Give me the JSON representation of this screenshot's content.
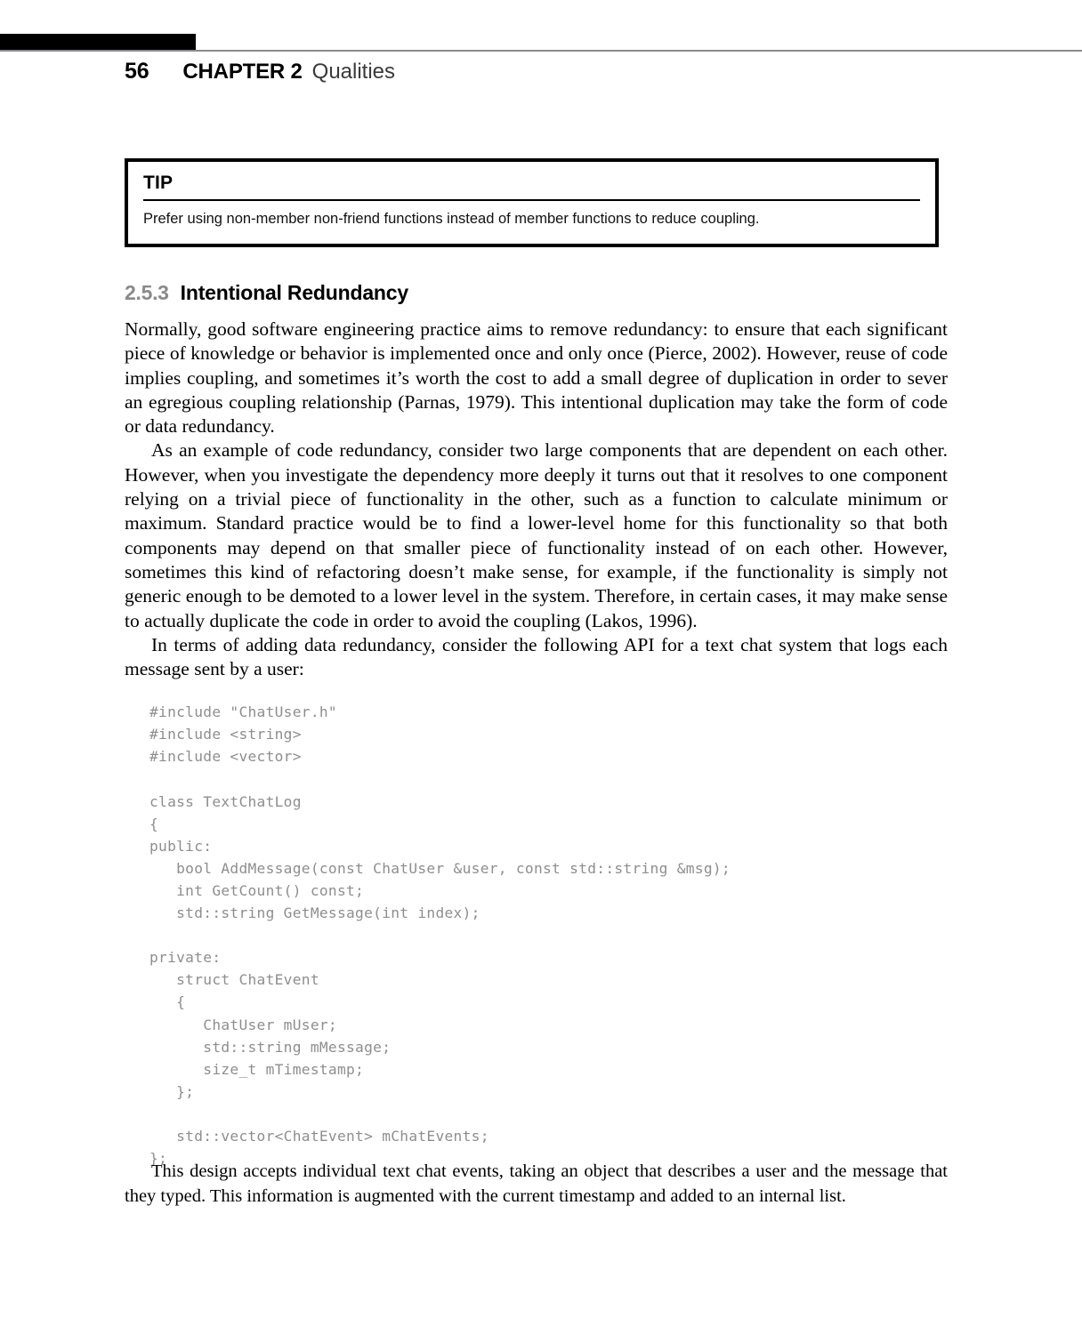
{
  "running_head": {
    "folio": "56",
    "chapter_label": "CHAPTER 2",
    "chapter_title": "Qualities"
  },
  "tip_box": {
    "heading": "TIP",
    "text": "Prefer using non-member non-friend functions instead of member functions to reduce coupling."
  },
  "section": {
    "number": "2.5.3",
    "title": "Intentional Redundancy"
  },
  "paragraphs": [
    "Normally, good software engineering practice aims to remove redundancy: to ensure that each significant piece of knowledge or behavior is implemented once and only once (Pierce, 2002). However, reuse of code implies coupling, and sometimes it’s worth the cost to add a small degree of duplication in order to sever an egregious coupling relationship (Parnas, 1979). This intentional duplication may take the form of code or data redundancy.",
    "As an example of code redundancy, consider two large components that are dependent on each other. However, when you investigate the dependency more deeply it turns out that it resolves to one component relying on a trivial piece of functionality in the other, such as a function to calculate minimum or maximum. Standard practice would be to find a lower-level home for this functionality so that both components may depend on that smaller piece of functionality instead of on each other. However, sometimes this kind of refactoring doesn’t make sense, for example, if the functionality is simply not generic enough to be demoted to a lower level in the system. Therefore, in certain cases, it may make sense to actually duplicate the code in order to avoid the coupling (Lakos, 1996).",
    "In terms of adding data redundancy, consider the following API for a text chat system that logs each message sent by a user:"
  ],
  "code_listing": "#include \"ChatUser.h\"\n#include <string>\n#include <vector>\n\nclass TextChatLog\n{\npublic:\n   bool AddMessage(const ChatUser &user, const std::string &msg);\n   int GetCount() const;\n   std::string GetMessage(int index);\n\nprivate:\n   struct ChatEvent\n   {\n      ChatUser mUser;\n      std::string mMessage;\n      size_t mTimestamp;\n   };\n\n   std::vector<ChatEvent> mChatEvents;\n};",
  "closing_paragraph": "This design accepts individual text chat events, taking an object that describes a user and the message that they typed. This information is augmented with the current timestamp and added to an internal list.",
  "colors": {
    "rule_gray": "#8b8b8e",
    "section_number_gray": "#8a8a8a",
    "code_gray": "#8e8e8e",
    "chapter_title_gray": "#3a3a3a",
    "black": "#000000"
  }
}
